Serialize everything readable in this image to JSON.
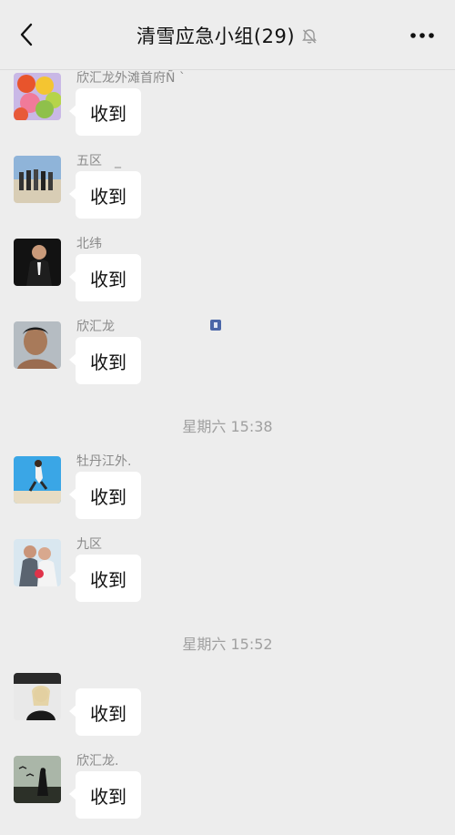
{
  "header": {
    "back_icon": "chevron-left-icon",
    "title": "清雪应急小组(29)",
    "mute_icon": "bell-off-icon",
    "more_icon": "more-dots-icon"
  },
  "messages": [
    {
      "sender": "欣汇龙外滩首府Ñ ˋ",
      "text": "收到"
    },
    {
      "sender": "五区　_",
      "text": "收到"
    },
    {
      "sender": "北纬",
      "text": "收到"
    },
    {
      "sender": "欣汇龙",
      "text": "收到"
    },
    {
      "sender": "牡丹江外.",
      "text": "收到"
    },
    {
      "sender": "九区",
      "text": "收到"
    },
    {
      "sender": "",
      "text": "收到"
    },
    {
      "sender": "欣汇龙.",
      "text": "收到"
    }
  ],
  "timestamps": [
    "星期六 15:38",
    "星期六 15:52"
  ]
}
